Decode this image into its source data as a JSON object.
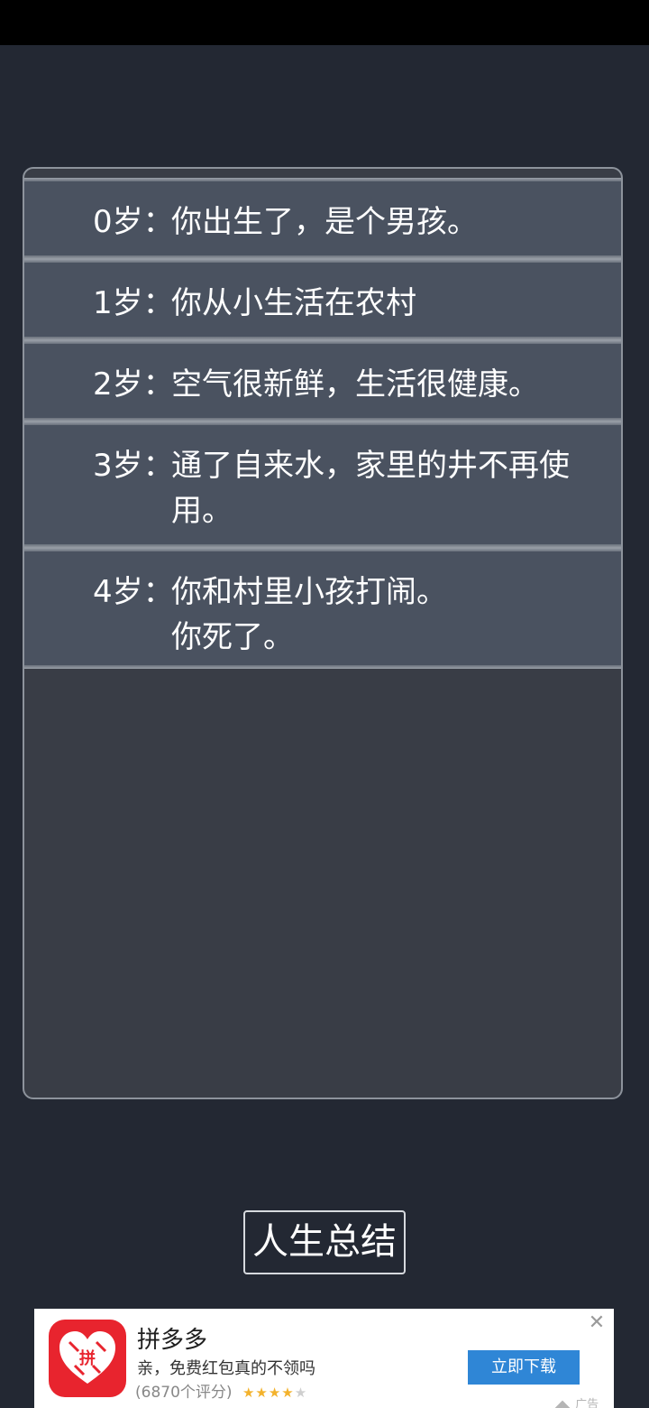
{
  "entries": [
    {
      "age": "0岁：",
      "text": "你出生了，是个男孩。"
    },
    {
      "age": "1岁：",
      "text": "你从小生活在农村"
    },
    {
      "age": "2岁：",
      "text": "空气很新鲜，生活很健康。"
    },
    {
      "age": "3岁：",
      "text": "通了自来水，家里的井不再使用。"
    },
    {
      "age": "4岁：",
      "text": "你和村里小孩打闹。"
    },
    {
      "age": "",
      "text": "你死了。"
    }
  ],
  "summary_button": {
    "label": "人生总结"
  },
  "ad": {
    "app_name": "拼多多",
    "description": "亲，免费红包真的不领吗",
    "rating_count": "(6870个评分)",
    "rating_value": 4,
    "download_label": "立即下载",
    "close_glyph": "✕",
    "ad_tag": "广告",
    "icon": "pinduoduo-app-icon",
    "icon_glyph": "拼",
    "brand_color": "#e8242e",
    "button_color": "#2f86d6"
  }
}
